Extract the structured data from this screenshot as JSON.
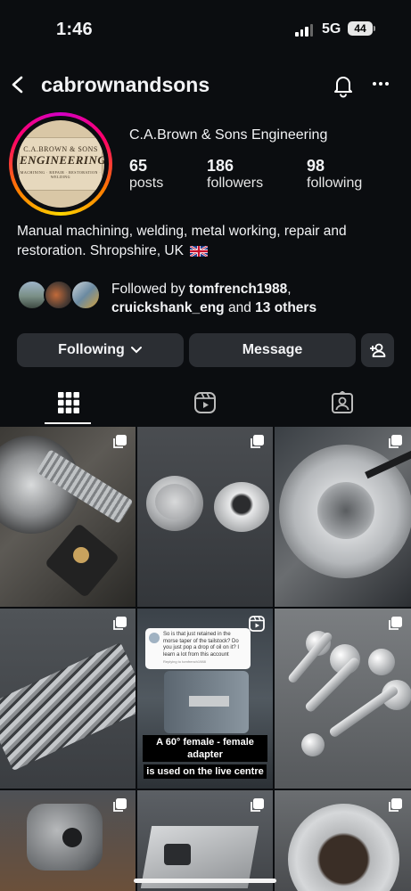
{
  "status_bar": {
    "time": "1:46",
    "network": "5G",
    "battery": "44"
  },
  "header": {
    "username": "cabrownandsons",
    "back_icon": "chevron-left-icon",
    "notification_icon": "bell-icon",
    "more_icon": "ellipsis-icon"
  },
  "profile": {
    "logo_text": {
      "line1": "C.A.BROWN & SONS",
      "line2": "ENGINEERING",
      "line3": "MACHINING · REPAIR · RESTORATION · WELDING"
    },
    "full_name": "C.A.Brown & Sons Engineering",
    "stats": [
      {
        "value": "65",
        "label": "posts"
      },
      {
        "value": "186",
        "label": "followers"
      },
      {
        "value": "98",
        "label": "following"
      }
    ],
    "bio_line1": "Manual machining, welding, metal working, repair and",
    "bio_line2": "restoration. Shropshire, UK",
    "followed_prefix": "Followed by ",
    "followed_user1": "tomfrench1988",
    "followed_user2": "cruickshank_eng",
    "followed_and": " and ",
    "followed_others": "13 others"
  },
  "actions": {
    "following_label": "Following",
    "message_label": "Message",
    "add_user_icon": "add-person-icon"
  },
  "tabs": [
    "grid-icon",
    "reels-icon",
    "tagged-icon"
  ],
  "reel": {
    "bubble_text": "So is that just retained in the morse taper of the tailstock? Do you just pop a drop of oil on it? I learn a lot from this account",
    "bubble_sub": "Replying to tomfrench1988",
    "caption_line1": "A 60° female - female adapter",
    "caption_line2": "is used on the live centre"
  },
  "colors": {
    "background": "#0b0d10",
    "button": "#2b2e33",
    "text": "#f2f3f5"
  }
}
